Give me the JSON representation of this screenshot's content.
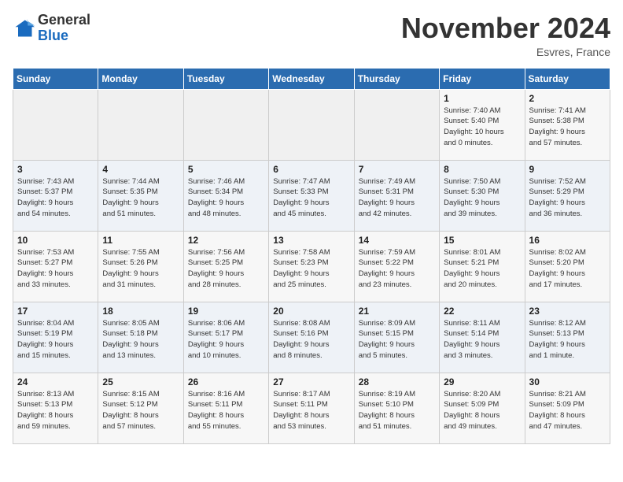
{
  "logo": {
    "general": "General",
    "blue": "Blue"
  },
  "title": "November 2024",
  "location": "Esvres, France",
  "headers": [
    "Sunday",
    "Monday",
    "Tuesday",
    "Wednesday",
    "Thursday",
    "Friday",
    "Saturday"
  ],
  "weeks": [
    [
      {
        "day": "",
        "info": ""
      },
      {
        "day": "",
        "info": ""
      },
      {
        "day": "",
        "info": ""
      },
      {
        "day": "",
        "info": ""
      },
      {
        "day": "",
        "info": ""
      },
      {
        "day": "1",
        "info": "Sunrise: 7:40 AM\nSunset: 5:40 PM\nDaylight: 10 hours\nand 0 minutes."
      },
      {
        "day": "2",
        "info": "Sunrise: 7:41 AM\nSunset: 5:38 PM\nDaylight: 9 hours\nand 57 minutes."
      }
    ],
    [
      {
        "day": "3",
        "info": "Sunrise: 7:43 AM\nSunset: 5:37 PM\nDaylight: 9 hours\nand 54 minutes."
      },
      {
        "day": "4",
        "info": "Sunrise: 7:44 AM\nSunset: 5:35 PM\nDaylight: 9 hours\nand 51 minutes."
      },
      {
        "day": "5",
        "info": "Sunrise: 7:46 AM\nSunset: 5:34 PM\nDaylight: 9 hours\nand 48 minutes."
      },
      {
        "day": "6",
        "info": "Sunrise: 7:47 AM\nSunset: 5:33 PM\nDaylight: 9 hours\nand 45 minutes."
      },
      {
        "day": "7",
        "info": "Sunrise: 7:49 AM\nSunset: 5:31 PM\nDaylight: 9 hours\nand 42 minutes."
      },
      {
        "day": "8",
        "info": "Sunrise: 7:50 AM\nSunset: 5:30 PM\nDaylight: 9 hours\nand 39 minutes."
      },
      {
        "day": "9",
        "info": "Sunrise: 7:52 AM\nSunset: 5:29 PM\nDaylight: 9 hours\nand 36 minutes."
      }
    ],
    [
      {
        "day": "10",
        "info": "Sunrise: 7:53 AM\nSunset: 5:27 PM\nDaylight: 9 hours\nand 33 minutes."
      },
      {
        "day": "11",
        "info": "Sunrise: 7:55 AM\nSunset: 5:26 PM\nDaylight: 9 hours\nand 31 minutes."
      },
      {
        "day": "12",
        "info": "Sunrise: 7:56 AM\nSunset: 5:25 PM\nDaylight: 9 hours\nand 28 minutes."
      },
      {
        "day": "13",
        "info": "Sunrise: 7:58 AM\nSunset: 5:23 PM\nDaylight: 9 hours\nand 25 minutes."
      },
      {
        "day": "14",
        "info": "Sunrise: 7:59 AM\nSunset: 5:22 PM\nDaylight: 9 hours\nand 23 minutes."
      },
      {
        "day": "15",
        "info": "Sunrise: 8:01 AM\nSunset: 5:21 PM\nDaylight: 9 hours\nand 20 minutes."
      },
      {
        "day": "16",
        "info": "Sunrise: 8:02 AM\nSunset: 5:20 PM\nDaylight: 9 hours\nand 17 minutes."
      }
    ],
    [
      {
        "day": "17",
        "info": "Sunrise: 8:04 AM\nSunset: 5:19 PM\nDaylight: 9 hours\nand 15 minutes."
      },
      {
        "day": "18",
        "info": "Sunrise: 8:05 AM\nSunset: 5:18 PM\nDaylight: 9 hours\nand 13 minutes."
      },
      {
        "day": "19",
        "info": "Sunrise: 8:06 AM\nSunset: 5:17 PM\nDaylight: 9 hours\nand 10 minutes."
      },
      {
        "day": "20",
        "info": "Sunrise: 8:08 AM\nSunset: 5:16 PM\nDaylight: 9 hours\nand 8 minutes."
      },
      {
        "day": "21",
        "info": "Sunrise: 8:09 AM\nSunset: 5:15 PM\nDaylight: 9 hours\nand 5 minutes."
      },
      {
        "day": "22",
        "info": "Sunrise: 8:11 AM\nSunset: 5:14 PM\nDaylight: 9 hours\nand 3 minutes."
      },
      {
        "day": "23",
        "info": "Sunrise: 8:12 AM\nSunset: 5:13 PM\nDaylight: 9 hours\nand 1 minute."
      }
    ],
    [
      {
        "day": "24",
        "info": "Sunrise: 8:13 AM\nSunset: 5:13 PM\nDaylight: 8 hours\nand 59 minutes."
      },
      {
        "day": "25",
        "info": "Sunrise: 8:15 AM\nSunset: 5:12 PM\nDaylight: 8 hours\nand 57 minutes."
      },
      {
        "day": "26",
        "info": "Sunrise: 8:16 AM\nSunset: 5:11 PM\nDaylight: 8 hours\nand 55 minutes."
      },
      {
        "day": "27",
        "info": "Sunrise: 8:17 AM\nSunset: 5:11 PM\nDaylight: 8 hours\nand 53 minutes."
      },
      {
        "day": "28",
        "info": "Sunrise: 8:19 AM\nSunset: 5:10 PM\nDaylight: 8 hours\nand 51 minutes."
      },
      {
        "day": "29",
        "info": "Sunrise: 8:20 AM\nSunset: 5:09 PM\nDaylight: 8 hours\nand 49 minutes."
      },
      {
        "day": "30",
        "info": "Sunrise: 8:21 AM\nSunset: 5:09 PM\nDaylight: 8 hours\nand 47 minutes."
      }
    ]
  ]
}
